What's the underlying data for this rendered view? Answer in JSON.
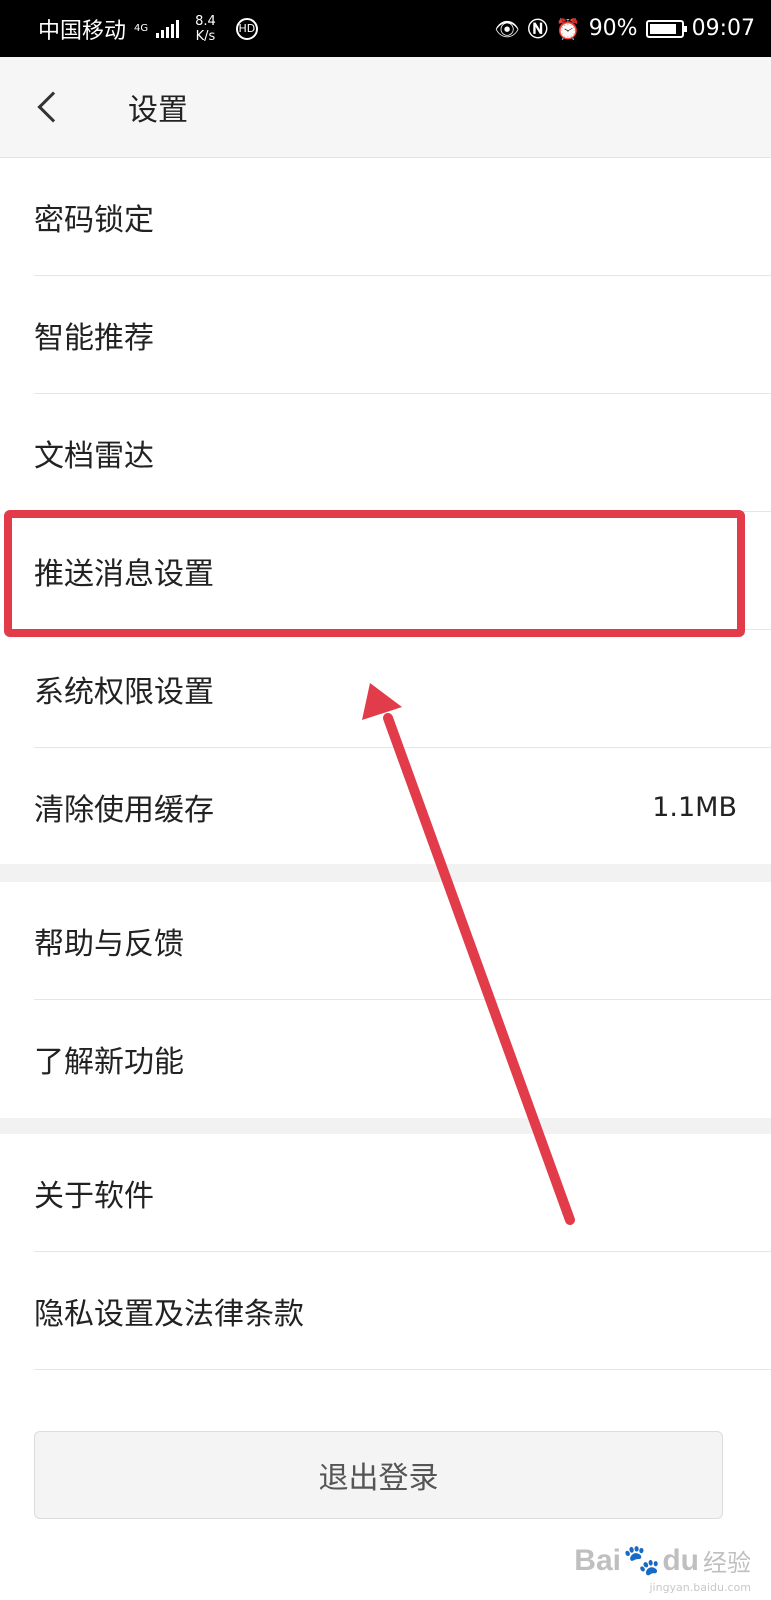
{
  "status_bar": {
    "carrier": "中国移动",
    "network": "4G",
    "speed_value": "8.4",
    "speed_unit": "K/s",
    "badge": "HD",
    "battery_percent": 90,
    "battery_text": "90%",
    "time": "09:07",
    "icons": [
      "eye-icon",
      "nfc-icon",
      "alarm-icon",
      "battery-icon"
    ]
  },
  "header": {
    "title": "设置",
    "back_icon": "chevron-left-icon"
  },
  "groups": [
    {
      "items": [
        {
          "label": "密码锁定",
          "value": ""
        },
        {
          "label": "智能推荐",
          "value": ""
        },
        {
          "label": "文档雷达",
          "value": ""
        },
        {
          "label": "推送消息设置",
          "value": ""
        },
        {
          "label": "系统权限设置",
          "value": ""
        },
        {
          "label": "清除使用缓存",
          "value": "1.1MB"
        }
      ]
    },
    {
      "items": [
        {
          "label": "帮助与反馈",
          "value": ""
        },
        {
          "label": "了解新功能",
          "value": ""
        }
      ]
    },
    {
      "items": [
        {
          "label": "关于软件",
          "value": ""
        },
        {
          "label": "隐私设置及法律条款",
          "value": ""
        }
      ]
    }
  ],
  "logout_label": "退出登录",
  "annotation": {
    "highlighted_item": "推送消息设置",
    "color": "#e23b4a"
  },
  "watermark": {
    "logo_text": "Bai",
    "logo_text2": "du",
    "cn_text": "经验",
    "url": "jingyan.baidu.com"
  }
}
